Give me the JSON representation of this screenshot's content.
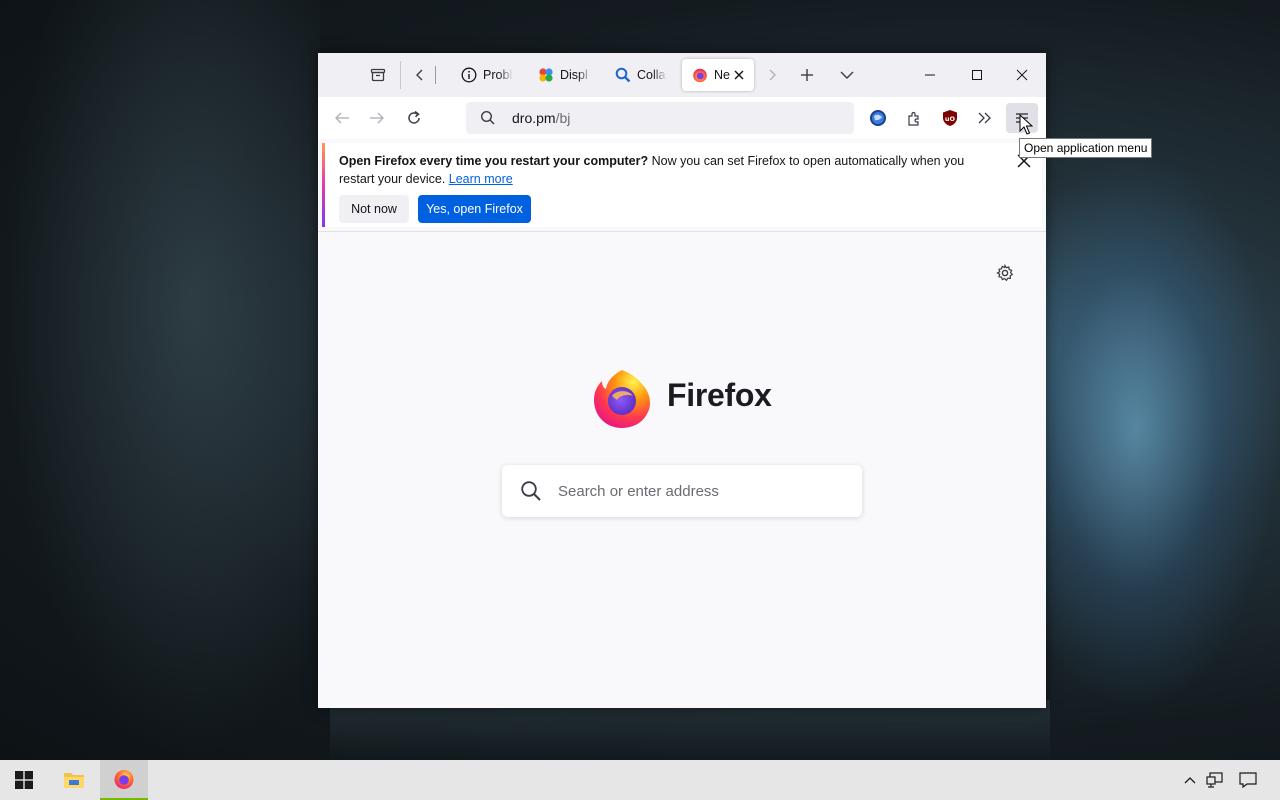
{
  "browser": {
    "tabs": [
      {
        "label": "Probl",
        "icon": "info-icon"
      },
      {
        "label": "Displ",
        "icon": "colorful-grid-icon"
      },
      {
        "label": "Colla",
        "icon": "magnifier-icon"
      },
      {
        "label": "Ne",
        "icon": "firefox-icon",
        "active": true
      }
    ],
    "url": {
      "host": "dro.pm",
      "path": "/bj"
    },
    "tooltip": "Open application menu"
  },
  "notification": {
    "bold": "Open Firefox every time you restart your computer?",
    "text": " Now you can set Firefox to open automatically when you restart your device. ",
    "link": "Learn more",
    "not_now": "Not now",
    "yes": "Yes, open Firefox"
  },
  "newtab": {
    "wordmark": "Firefox",
    "search_placeholder": "Search or enter address"
  },
  "colors": {
    "accent": "#0061e0",
    "tab_bar": "#f0f0f4",
    "ublock": "#800000"
  }
}
